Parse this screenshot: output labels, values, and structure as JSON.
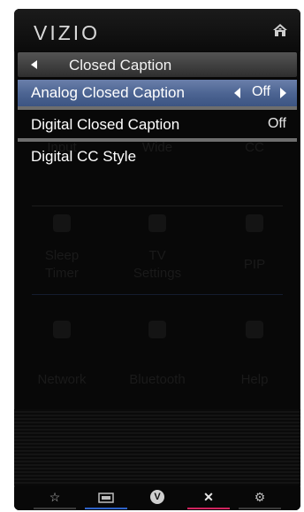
{
  "header": {
    "logo": "VIZIO",
    "home_icon": "home-icon"
  },
  "subheader": {
    "back_icon": "left-triangle-icon",
    "title": "Closed Caption"
  },
  "menu": [
    {
      "label": "Analog Closed Caption",
      "value": "Off",
      "selected": true
    },
    {
      "label": "Digital Closed Caption",
      "value": "Off",
      "selected": false
    },
    {
      "label": "Digital CC Style",
      "value": "",
      "selected": false
    }
  ],
  "background_menu": {
    "labels": [
      "Input",
      "Wide",
      "CC",
      "Sleep",
      "Timer",
      "TV",
      "Settings",
      "PIP",
      "Network",
      "Bluetooth",
      "Help"
    ]
  },
  "bottom_bar": [
    {
      "icon": "star-icon",
      "glyph": "☆",
      "underline": "#3a3a3a"
    },
    {
      "icon": "screen-icon",
      "glyph": "",
      "underline": "#2f63c9"
    },
    {
      "icon": "vizio-v-icon",
      "glyph": "V",
      "underline": ""
    },
    {
      "icon": "close-icon",
      "glyph": "✕",
      "underline": "#d0245f"
    },
    {
      "icon": "gear-icon",
      "glyph": "⚙",
      "underline": "#3a3a3a"
    }
  ],
  "colors": {
    "selected_row": "#4b6391",
    "subbar": "#3e3e3e",
    "background": "#080808"
  }
}
